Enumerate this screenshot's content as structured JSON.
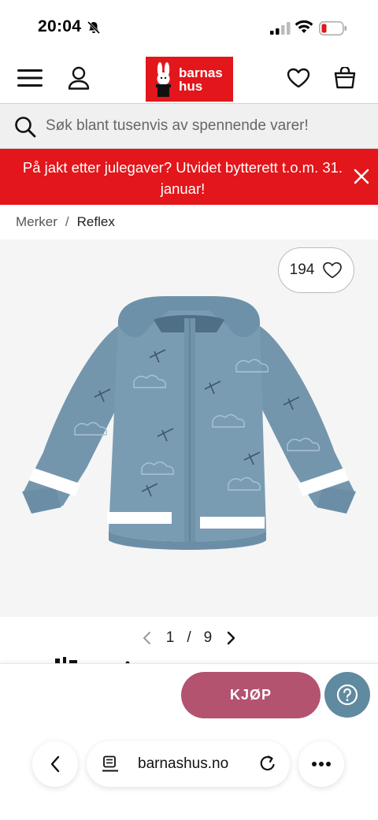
{
  "status_bar": {
    "time": "20:04",
    "icons": [
      "bell-muted-icon",
      "signal-icon",
      "wifi-icon",
      "battery-low-icon"
    ],
    "battery_color": "#e2161b"
  },
  "header": {
    "logo_line1": "barnas",
    "logo_line2": "hus",
    "brand_color": "#e2161b",
    "icons": [
      "menu-icon",
      "user-icon",
      "heart-icon",
      "shopping-bag-icon"
    ]
  },
  "search": {
    "placeholder": "Søk blant tusenvis av spennende varer!"
  },
  "banner": {
    "text": "På jakt etter julegaver? Utvidet bytterett t.o.m. 31. januar!",
    "color": "#e2161b"
  },
  "breadcrumb": {
    "items": [
      "Merker",
      "Reflex"
    ],
    "separator": "/"
  },
  "product": {
    "wishlist_count": "194",
    "jacket_color": "#7496ad",
    "reflective_band_color": "#ffffff",
    "pager": {
      "current": "1",
      "separator": "/",
      "total": "9"
    }
  },
  "buy_bar": {
    "buy_label": "KJØP",
    "buy_color": "#b3536f",
    "help_color": "#5f8aa0"
  },
  "browser": {
    "url": "barnashus.no",
    "icons": [
      "back-icon",
      "site-settings-icon",
      "reload-icon",
      "more-icon"
    ]
  }
}
